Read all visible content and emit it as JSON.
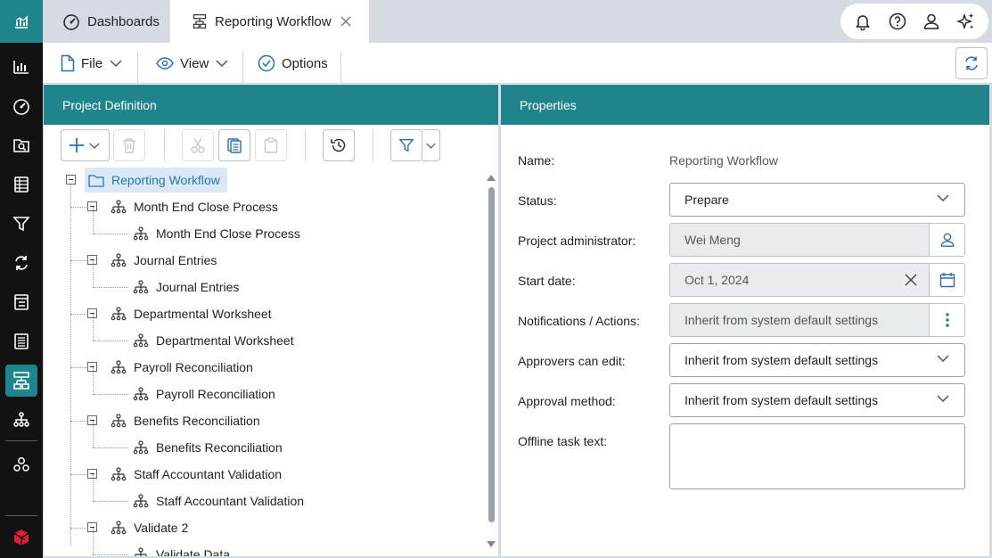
{
  "tabs": [
    {
      "label": "Dashboards",
      "icon": "gauge-icon"
    },
    {
      "label": "Reporting Workflow",
      "icon": "workflow-icon"
    }
  ],
  "toolbar": {
    "file_label": "File",
    "view_label": "View",
    "options_label": "Options"
  },
  "left_panel": {
    "title": "Project Definition"
  },
  "tree": {
    "root": "Reporting Workflow",
    "groups": [
      {
        "label": "Month End Close Process",
        "child": "Month End Close Process"
      },
      {
        "label": "Journal Entries",
        "child": "Journal Entries"
      },
      {
        "label": "Departmental Worksheet",
        "child": "Departmental Worksheet"
      },
      {
        "label": "Payroll Reconciliation",
        "child": "Payroll Reconciliation"
      },
      {
        "label": "Benefits Reconciliation",
        "child": "Benefits Reconciliation"
      },
      {
        "label": "Staff Accountant Validation",
        "child": "Staff Accountant Validation"
      },
      {
        "label": "Validate 2",
        "child": "Validate Data"
      }
    ]
  },
  "right_panel": {
    "title": "Properties"
  },
  "properties": {
    "name_label": "Name:",
    "name_value": "Reporting Workflow",
    "status_label": "Status:",
    "status_value": "Prepare",
    "admin_label": "Project administrator:",
    "admin_value": "Wei Meng",
    "start_label": "Start date:",
    "start_value": "Oct 1, 2024",
    "notif_label": "Notifications / Actions:",
    "notif_value": "Inherit from system default settings",
    "approvers_label": "Approvers can edit:",
    "approvers_value": "Inherit from system default settings",
    "method_label": "Approval method:",
    "method_value": "Inherit from system default settings",
    "offline_label": "Offline task text:",
    "offline_value": ""
  },
  "colors": {
    "accent": "#20848d",
    "rail": "#121212",
    "tabstrip": "#d6dbe3",
    "selection": "#dbe9f6",
    "selection_text": "#2a73b5"
  }
}
